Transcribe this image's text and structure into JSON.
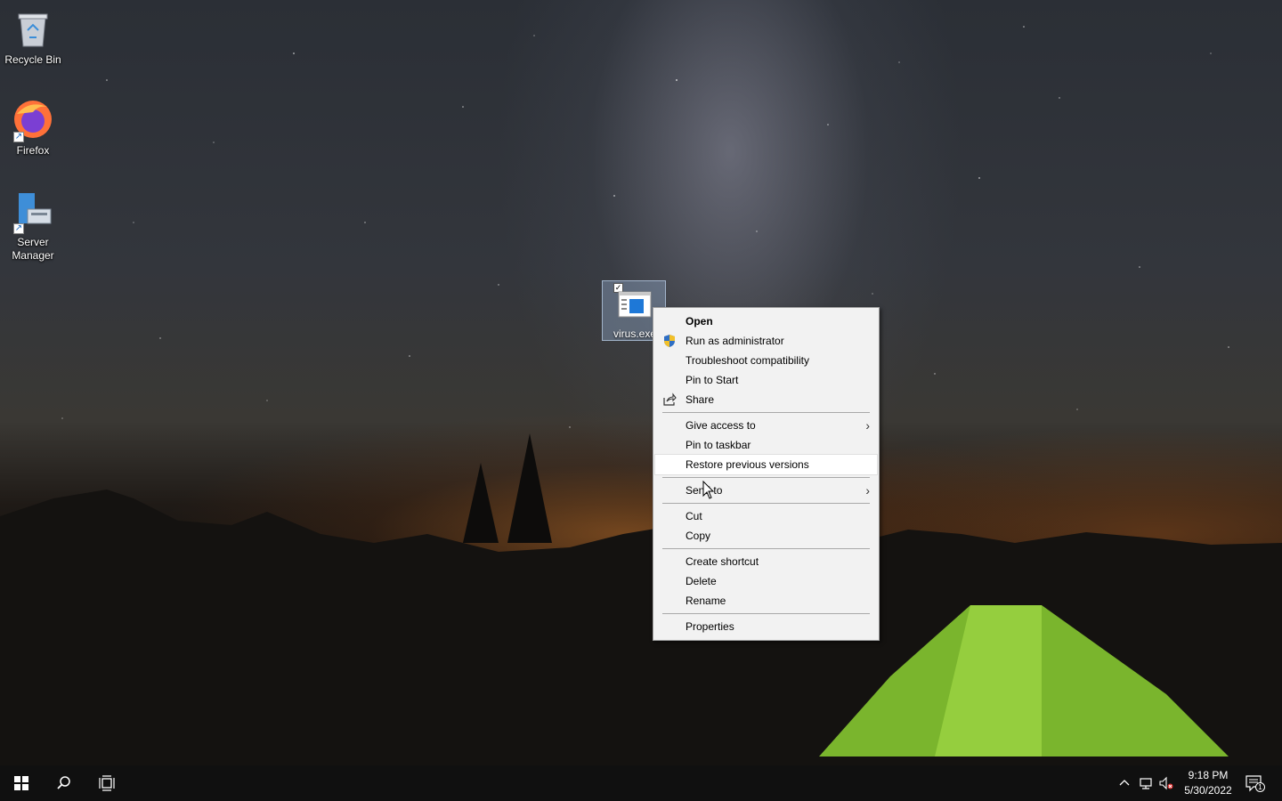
{
  "desktop": {
    "icons": [
      {
        "label": "Recycle Bin"
      },
      {
        "label": "Firefox"
      },
      {
        "label": "Server Manager"
      },
      {
        "label": "virus.exe"
      }
    ]
  },
  "context_menu": {
    "items": {
      "open": "Open",
      "run_as_admin": "Run as administrator",
      "troubleshoot": "Troubleshoot compatibility",
      "pin_start": "Pin to Start",
      "share": "Share",
      "give_access": "Give access to",
      "pin_taskbar": "Pin to taskbar",
      "restore_versions": "Restore previous versions",
      "send_to": "Send to",
      "cut": "Cut",
      "copy": "Copy",
      "create_shortcut": "Create shortcut",
      "delete": "Delete",
      "rename": "Rename",
      "properties": "Properties"
    },
    "hovered_item": "Restore previous versions"
  },
  "taskbar": {
    "time": "9:18 PM",
    "date": "5/30/2022",
    "notification_count": "1",
    "icons": [
      "start-icon",
      "search-icon",
      "task-view-icon",
      "show-hidden-icons-chevron",
      "network-icon",
      "volume-muted-icon",
      "action-center-icon"
    ]
  },
  "colors": {
    "taskbar": "#101010",
    "menu_background": "#f2f2f2",
    "selection": "#a0bee1",
    "tent": "#8ed13a"
  }
}
